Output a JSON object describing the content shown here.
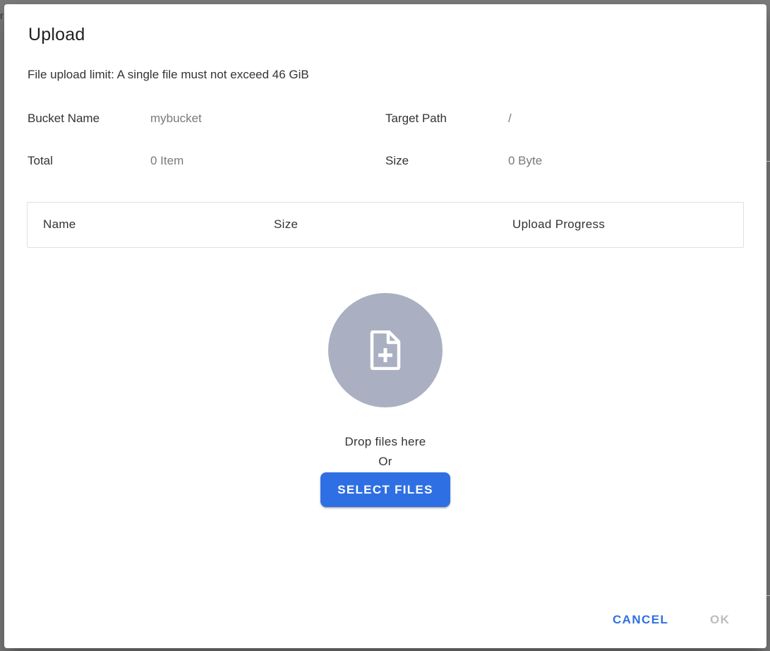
{
  "backdrop": {
    "edge_char": "r"
  },
  "dialog": {
    "title": "Upload",
    "limit_text": "File upload limit: A single file must not exceed 46 GiB",
    "info": {
      "bucket_label": "Bucket Name",
      "bucket_value": "mybucket",
      "target_label": "Target Path",
      "target_value": "/",
      "total_label": "Total",
      "total_value": "0 Item",
      "size_label": "Size",
      "size_value": "0 Byte"
    },
    "table": {
      "columns": [
        "Name",
        "Size",
        "Upload Progress"
      ]
    },
    "drop": {
      "icon": "file-plus-icon",
      "text": "Drop files here",
      "or_text": "Or",
      "select_label": "SELECT FILES"
    },
    "actions": {
      "cancel_label": "CANCEL",
      "ok_label": "OK"
    }
  },
  "colors": {
    "accent": "#2f6fe4",
    "circle": "#aab0c2",
    "disabled": "#bdbdbd"
  }
}
